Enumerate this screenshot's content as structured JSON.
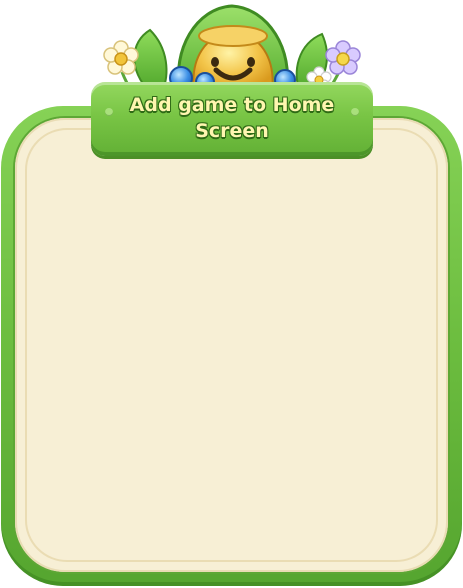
{
  "dialog": {
    "title": "Add game to Home Screen"
  },
  "decorations": {
    "mascot": "smiling-bell-sprout-mascot",
    "left_flower": "yellow-daisy-icon",
    "right_flower": "purple-daisy-icon",
    "small_flower": "white-daisy-icon",
    "gems": "blue-gem-icon"
  },
  "colors": {
    "frame_green": "#6cbd3f",
    "panel_cream": "#f7efd5",
    "title_text": "#fff6b0",
    "title_outline": "#2f6b16"
  }
}
